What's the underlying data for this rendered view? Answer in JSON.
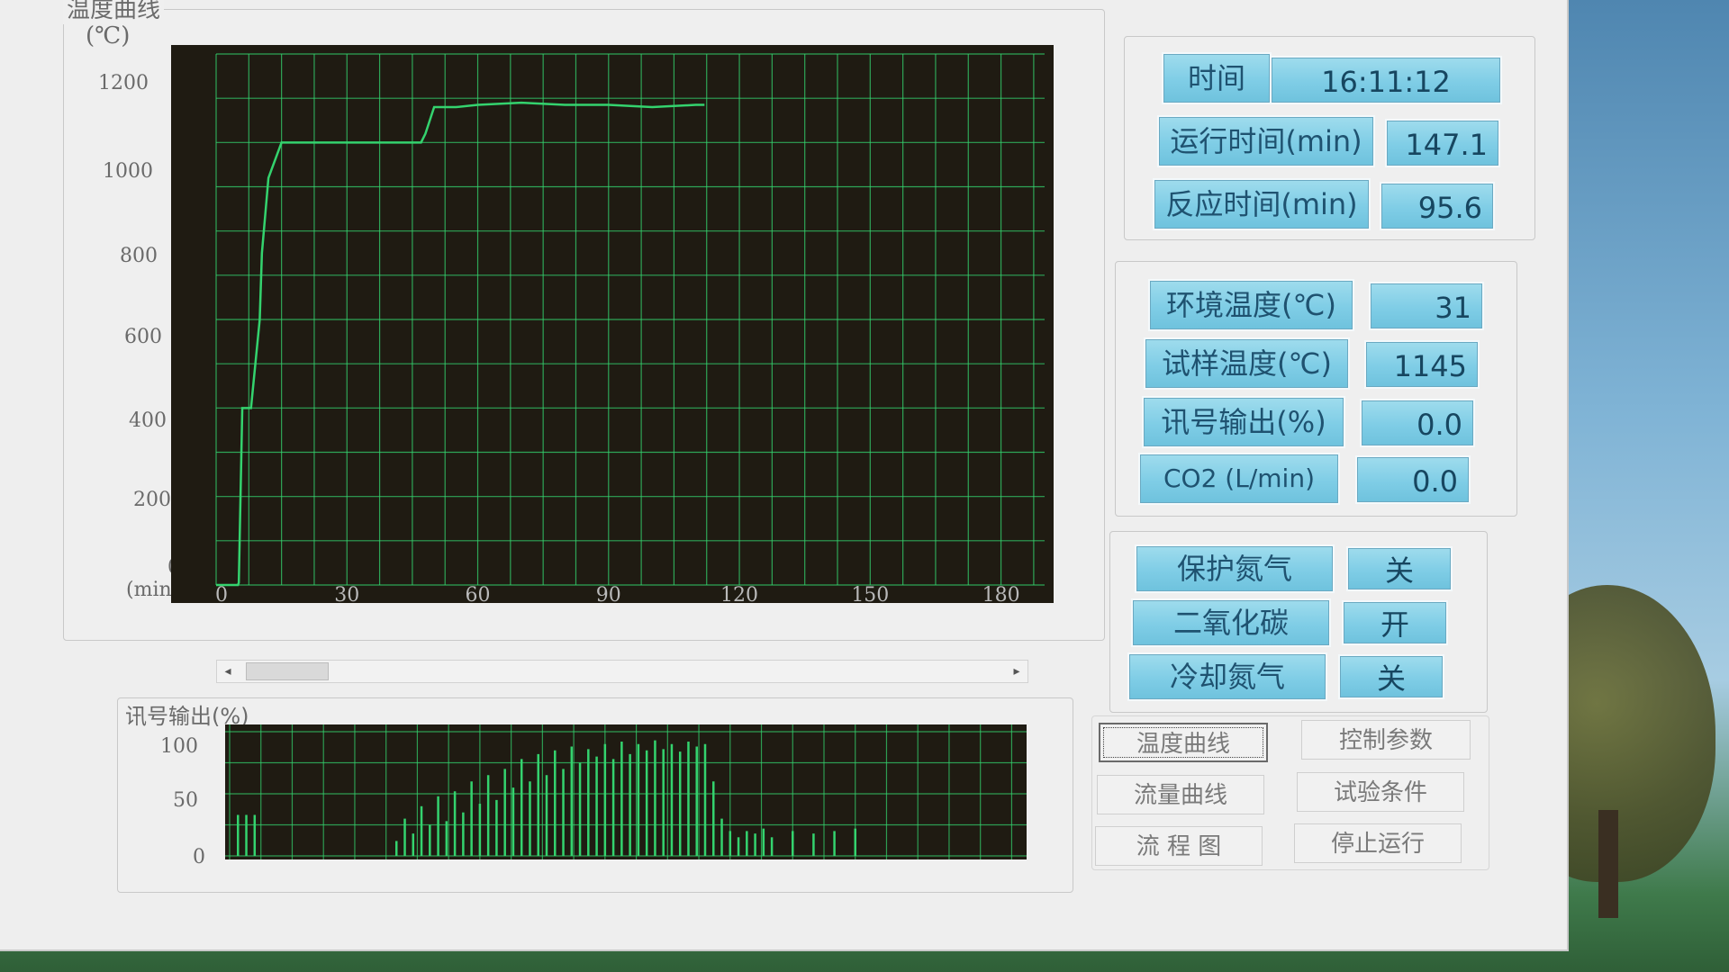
{
  "temperature_chart": {
    "title": "温度曲线",
    "unit": "(℃)",
    "x_unit": "(min)",
    "y_ticks": [
      "1200",
      "1000",
      "800",
      "600",
      "400",
      "200",
      "0"
    ],
    "x_ticks": [
      "0",
      "30",
      "60",
      "90",
      "120",
      "150",
      "180"
    ],
    "bg_color": "#1f1b12",
    "line_color": "#34d36e"
  },
  "signal_chart": {
    "title": "讯号输出(%)",
    "y_ticks": [
      "100",
      "50",
      "0"
    ]
  },
  "chart_data": [
    {
      "type": "line",
      "series": [
        {
          "x": [
            0,
            3,
            5,
            5.2,
            6,
            8,
            10,
            10.5,
            12,
            15,
            20,
            25,
            30,
            35,
            40,
            45,
            47,
            48,
            50,
            55,
            60,
            70,
            80,
            90,
            100,
            110,
            112
          ],
          "y": [
            0,
            0,
            0,
            5,
            400,
            400,
            600,
            750,
            920,
            1000,
            1000,
            1000,
            1000,
            1000,
            1000,
            1000,
            1000,
            1020,
            1080,
            1080,
            1085,
            1090,
            1085,
            1085,
            1080,
            1085,
            1085
          ]
        }
      ],
      "xlim": [
        0,
        190
      ],
      "ylim": [
        0,
        1200
      ],
      "grid": true
    },
    {
      "type": "bar",
      "x": [
        2,
        4,
        6,
        40,
        42,
        44,
        46,
        48,
        50,
        52,
        54,
        56,
        58,
        60,
        62,
        64,
        66,
        68,
        70,
        72,
        74,
        76,
        78,
        80,
        82,
        84,
        86,
        88,
        90,
        92,
        94,
        96,
        98,
        100,
        102,
        104,
        106,
        108,
        110,
        112,
        114,
        116,
        118,
        120,
        122,
        124,
        126,
        128,
        130,
        135,
        140,
        145,
        150
      ],
      "values": [
        33,
        33,
        33,
        12,
        30,
        18,
        40,
        25,
        48,
        28,
        52,
        35,
        60,
        42,
        65,
        45,
        70,
        55,
        78,
        60,
        82,
        65,
        85,
        70,
        88,
        75,
        86,
        80,
        90,
        78,
        92,
        82,
        90,
        85,
        93,
        86,
        90,
        84,
        92,
        88,
        90,
        60,
        30,
        20,
        15,
        20,
        18,
        22,
        15,
        20,
        18,
        20,
        22
      ],
      "ylim": [
        0,
        100
      ],
      "grid": true
    }
  ],
  "time_panel": {
    "rows": [
      {
        "label": "时间",
        "value": "16:11:12"
      },
      {
        "label": "运行时间(min)",
        "value": "147.1"
      },
      {
        "label": "反应时间(min)",
        "value": "95.6"
      }
    ]
  },
  "reading_panel": {
    "rows": [
      {
        "label": "环境温度(℃)",
        "value": "31"
      },
      {
        "label": "试样温度(℃)",
        "value": "1145"
      },
      {
        "label": "讯号输出(%)",
        "value": "0.0"
      },
      {
        "label": "CO2 (L/min)",
        "value": "0.0"
      }
    ]
  },
  "gas_panel": {
    "rows": [
      {
        "label": "保护氮气",
        "value": "关"
      },
      {
        "label": "二氧化碳",
        "value": "开"
      },
      {
        "label": "冷却氮气",
        "value": "关"
      }
    ]
  },
  "commands": {
    "temp_curve": "温度曲线",
    "control_params": "控制参数",
    "flow_curve": "流量曲线",
    "test_conditions": "试验条件",
    "flow_chart": "流 程 图",
    "stop_run": "停止运行"
  },
  "scrollbar": {
    "left_arrow": "◂",
    "right_arrow": "▸"
  }
}
